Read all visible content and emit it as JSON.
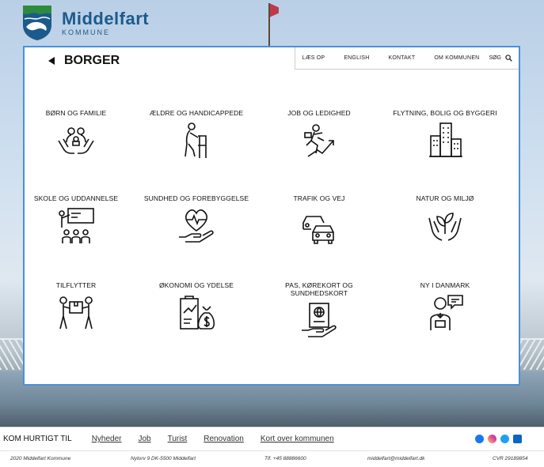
{
  "header": {
    "logo_name": "Middelfart",
    "logo_sub": "KOMMUNE"
  },
  "topnav": {
    "items": [
      "LÆS OP",
      "ENGLISH",
      "KONTAKT",
      "OM KOMMUNEN"
    ],
    "search_label": "SØG"
  },
  "page": {
    "title": "BORGER"
  },
  "tiles": [
    {
      "label": "BØRN OG FAMILIE",
      "icon": "family-hands-icon"
    },
    {
      "label": "ÆLDRE OG HANDICAPPEDE",
      "icon": "walker-icon"
    },
    {
      "label": "JOB OG LEDIGHED",
      "icon": "job-growth-icon"
    },
    {
      "label": "FLYTNING, BOLIG OG BYGGERI",
      "icon": "buildings-icon"
    },
    {
      "label": "SKOLE OG UDDANNELSE",
      "icon": "classroom-icon"
    },
    {
      "label": "SUNDHED OG FOREBYGGELSE",
      "icon": "heart-hand-icon"
    },
    {
      "label": "TRAFIK OG VEJ",
      "icon": "cars-icon"
    },
    {
      "label": "NATUR OG MILJØ",
      "icon": "plant-hands-icon"
    },
    {
      "label": "TILFLYTTER",
      "icon": "movers-icon"
    },
    {
      "label": "ØKONOMI OG YDELSE",
      "icon": "finance-icon"
    },
    {
      "label": "PAS, KØREKORT OG SUNDHEDSKORT",
      "icon": "passport-icon"
    },
    {
      "label": "NY I DANMARK",
      "icon": "newcomer-icon"
    }
  ],
  "footer": {
    "quick_title": "KOM HURTIGT TIL",
    "quick_links": [
      "Nyheder",
      "Job",
      "Turist",
      "Renovation",
      "Kort over kommunen"
    ],
    "social": [
      {
        "name": "facebook-icon",
        "color": "#1877f2"
      },
      {
        "name": "instagram-icon",
        "color": "#d6249f"
      },
      {
        "name": "twitter-icon",
        "color": "#1da1f2"
      },
      {
        "name": "linkedin-icon",
        "color": "#0a66c2"
      }
    ],
    "copyright": "2020 Middelfart Kommune",
    "address": "Nytorv 9 DK-5500 Middelfart",
    "phone": "Tlf. +45 88886600",
    "email": "middelfart@middelfart.dk",
    "cvr": "CVR 29189854"
  },
  "colors": {
    "accent": "#4a90d9",
    "brand": "#1c5a8c"
  }
}
